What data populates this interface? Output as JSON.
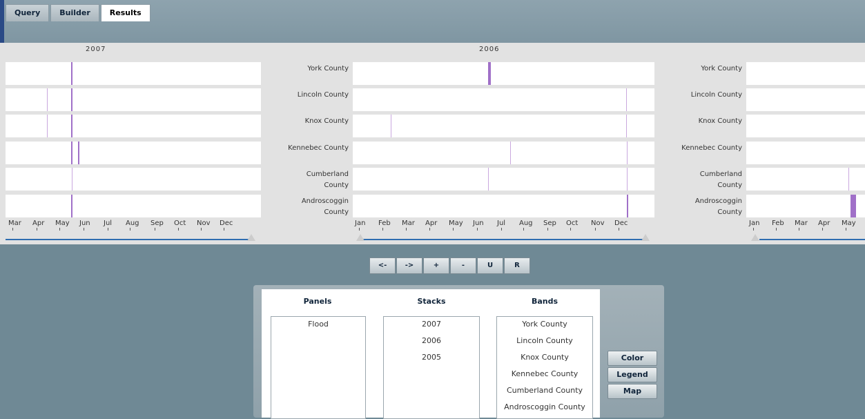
{
  "tabs": [
    "Query",
    "Builder",
    "Results"
  ],
  "active_tab": "Results",
  "stacks": [
    {
      "year": "2007",
      "bands": [
        {
          "label": ""
        },
        {
          "label": ""
        },
        {
          "label": ""
        },
        {
          "label": ""
        },
        {
          "label": ""
        },
        {
          "label": ""
        }
      ],
      "months": [
        "Mar",
        "Apr",
        "May",
        "Jun",
        "Jul",
        "Aug",
        "Sep",
        "Oct",
        "Nov",
        "Dec"
      ]
    },
    {
      "year": "2006",
      "bands": [
        {
          "label": "York County"
        },
        {
          "label": "Lincoln County"
        },
        {
          "label": "Knox County"
        },
        {
          "label": "Kennebec County"
        },
        {
          "label": "Cumberland County"
        },
        {
          "label": "Androscoggin County"
        }
      ],
      "months": [
        "Jan",
        "Feb",
        "Mar",
        "Apr",
        "May",
        "Jun",
        "Jul",
        "Aug",
        "Sep",
        "Oct",
        "Nov",
        "Dec"
      ]
    },
    {
      "year": "",
      "bands": [
        {
          "label": "York County"
        },
        {
          "label": "Lincoln County"
        },
        {
          "label": "Knox County"
        },
        {
          "label": "Kennebec County"
        },
        {
          "label": "Cumberland County"
        },
        {
          "label": "Androscoggin County"
        }
      ],
      "months": [
        "Jan",
        "Feb",
        "Mar",
        "Apr",
        "May"
      ]
    }
  ],
  "nav_buttons": [
    "<-",
    "->",
    "+",
    "-",
    "U",
    "R"
  ],
  "panels": {
    "headers": {
      "panels": "Panels",
      "stacks": "Stacks",
      "bands": "Bands"
    },
    "panels_list": [
      "Flood"
    ],
    "stacks_list": [
      "2007",
      "2006",
      "2005"
    ],
    "bands_list": [
      "York County",
      "Lincoln County",
      "Knox County",
      "Kennebec County",
      "Cumberland County",
      "Androscoggin County"
    ]
  },
  "side_buttons": [
    "Color",
    "Legend",
    "Map"
  ],
  "colors": {
    "event": "#a070c8",
    "slider": "#2f6db0"
  }
}
